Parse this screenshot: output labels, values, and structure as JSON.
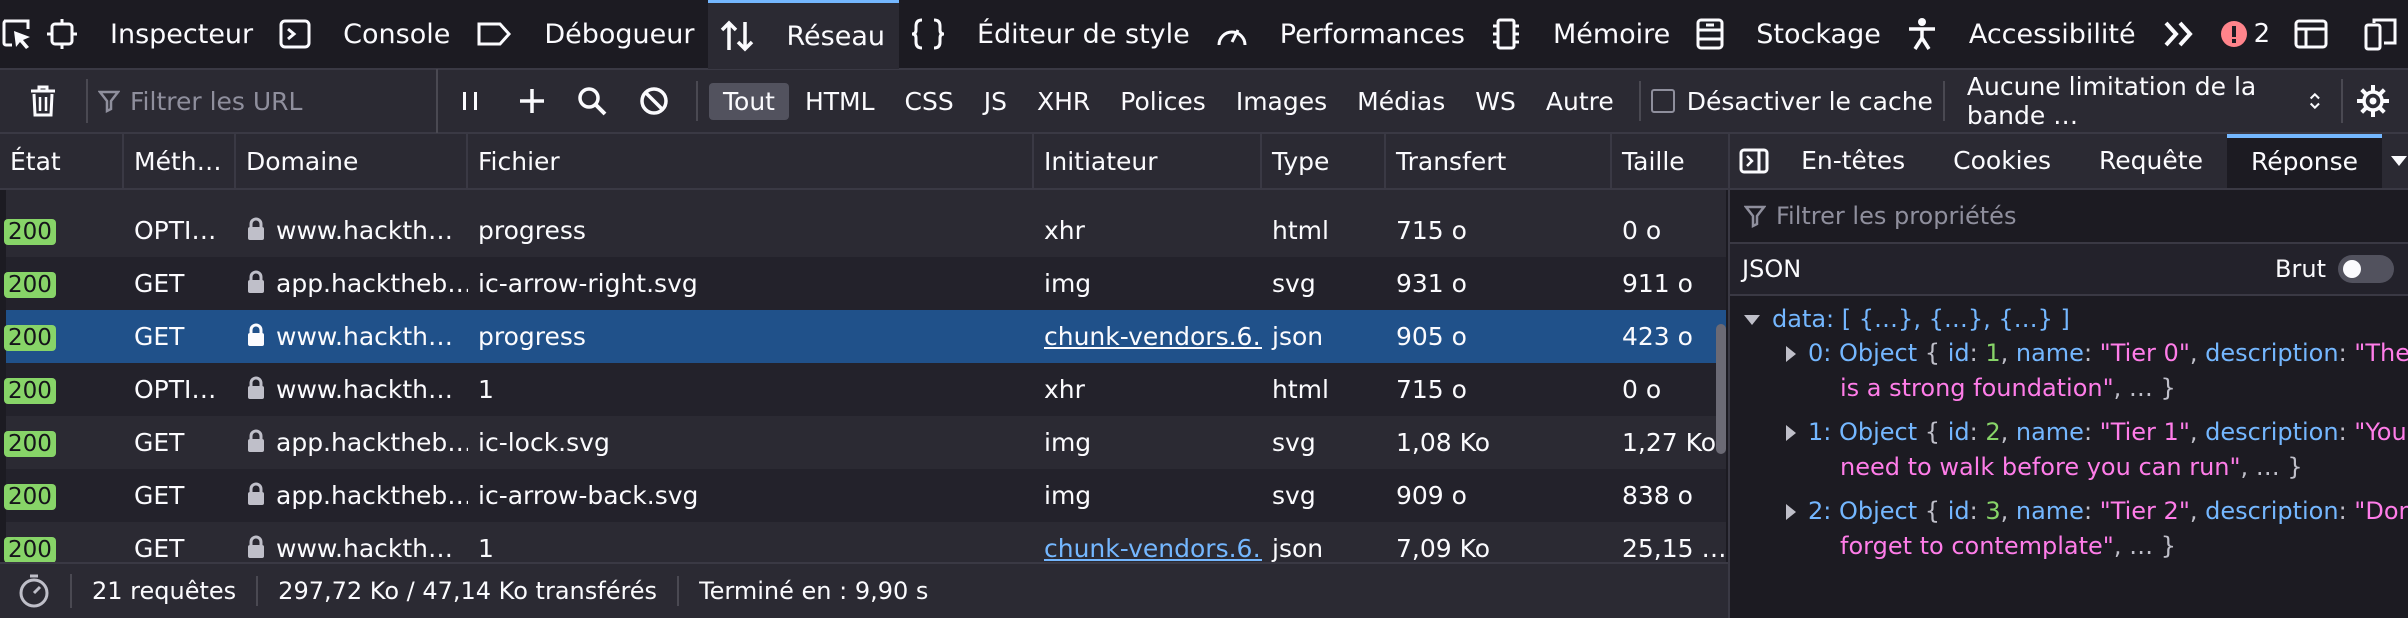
{
  "toolbox": {
    "tabs": [
      {
        "label": "Inspecteur",
        "icon": "inspector-icon"
      },
      {
        "label": "Console",
        "icon": "console-icon"
      },
      {
        "label": "Débogueur",
        "icon": "debugger-icon"
      },
      {
        "label": "Réseau",
        "icon": "network-icon",
        "active": true
      },
      {
        "label": "Éditeur de style",
        "icon": "style-editor-icon"
      },
      {
        "label": "Performances",
        "icon": "performance-icon"
      },
      {
        "label": "Mémoire",
        "icon": "memory-icon"
      },
      {
        "label": "Stockage",
        "icon": "storage-icon"
      },
      {
        "label": "Accessibilité",
        "icon": "accessibility-icon"
      }
    ],
    "error_count": "2"
  },
  "toolbar": {
    "filter_placeholder": "Filtrer les URL",
    "type_filters": [
      "Tout",
      "HTML",
      "CSS",
      "JS",
      "XHR",
      "Polices",
      "Images",
      "Médias",
      "WS",
      "Autre"
    ],
    "active_filter": "Tout",
    "disable_cache_label": "Désactiver le cache",
    "throttling_label": "Aucune limitation de la bande …"
  },
  "requests": {
    "columns": [
      "État",
      "Méth…",
      "Domaine",
      "Fichier",
      "Initiateur",
      "Type",
      "Transfert",
      "Taille"
    ],
    "rows": [
      {
        "status": "200",
        "method": "OPTI…",
        "domain": "www.hackth…",
        "file": "progress",
        "initiator": "xhr",
        "initiator_link": false,
        "type": "html",
        "transfer": "715 o",
        "size": "0 o"
      },
      {
        "status": "200",
        "method": "GET",
        "domain": "app.hackthеb…",
        "file": "ic-arrow-right.svg",
        "initiator": "img",
        "initiator_link": false,
        "type": "svg",
        "transfer": "931 o",
        "size": "911 o"
      },
      {
        "status": "200",
        "method": "GET",
        "domain": "www.hackth…",
        "file": "progress",
        "initiator": "chunk-vendors.6…",
        "initiator_link": true,
        "type": "json",
        "transfer": "905 o",
        "size": "423 o",
        "selected": true
      },
      {
        "status": "200",
        "method": "OPTI…",
        "domain": "www.hackth…",
        "file": "1",
        "initiator": "xhr",
        "initiator_link": false,
        "type": "html",
        "transfer": "715 o",
        "size": "0 o"
      },
      {
        "status": "200",
        "method": "GET",
        "domain": "app.hackthеb…",
        "file": "ic-lock.svg",
        "initiator": "img",
        "initiator_link": false,
        "type": "svg",
        "transfer": "1,08 Ko",
        "size": "1,27 Ko"
      },
      {
        "status": "200",
        "method": "GET",
        "domain": "app.hackthеb…",
        "file": "ic-arrow-back.svg",
        "initiator": "img",
        "initiator_link": false,
        "type": "svg",
        "transfer": "909 o",
        "size": "838 o"
      },
      {
        "status": "200",
        "method": "GET",
        "domain": "www.hackth…",
        "file": "1",
        "initiator": "chunk-vendors.6…",
        "initiator_link": true,
        "type": "json",
        "transfer": "7,09 Ko",
        "size": "25,15 …"
      }
    ]
  },
  "statusbar": {
    "requests": "21 requêtes",
    "transferred": "297,72 Ko / 47,14 Ko transférés",
    "finished": "Terminé en : 9,90 s"
  },
  "details": {
    "tabs": [
      "En-têtes",
      "Cookies",
      "Requête",
      "Réponse"
    ],
    "active_tab": "Réponse",
    "filter_placeholder": "Filtrer les propriétés",
    "format_label": "JSON",
    "raw_label": "Brut",
    "raw_enabled": false,
    "root_key": "data:",
    "root_summary": "[ {…}, {…}, {…} ]",
    "items": [
      {
        "index": "0:",
        "id": "1",
        "name": "\"Tier 0\"",
        "desc_head": "\"The key",
        "desc_tail": "is a strong foundation\""
      },
      {
        "index": "1:",
        "id": "2",
        "name": "\"Tier 1\"",
        "desc_head": "\"You",
        "desc_tail": "need to walk before you can run\""
      },
      {
        "index": "2:",
        "id": "3",
        "name": "\"Tier 2\"",
        "desc_head": "\"Don't",
        "desc_tail": "forget to contemplate\""
      }
    ]
  },
  "colors": {
    "background": "#1c1b22",
    "accent": "#74b7ff",
    "selected_row": "#20518a",
    "status_ok": "#87d468",
    "string": "#ff7de9"
  }
}
